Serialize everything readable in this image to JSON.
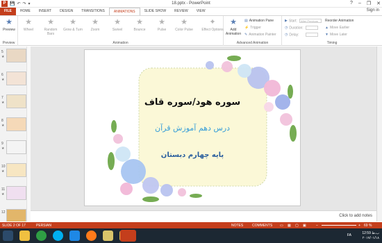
{
  "window": {
    "title": "18.pptx - PowerPoint",
    "controls": [
      "?",
      "–",
      "❐",
      "✕"
    ]
  },
  "quick_access": {
    "app_icon": "P",
    "icons": [
      "save-icon",
      "undo-icon",
      "redo-icon",
      "customize-icon"
    ]
  },
  "tabs": [
    "FILE",
    "HOME",
    "INSERT",
    "DESIGN",
    "TRANSITIONS",
    "ANIMATIONS",
    "SLIDE SHOW",
    "REVIEW",
    "VIEW"
  ],
  "active_tab": "ANIMATIONS",
  "sign_in": "Sign in",
  "ribbon": {
    "preview": {
      "label": "Preview",
      "group": "Preview"
    },
    "animation": {
      "group": "Animation",
      "effects": [
        "Wheel",
        "Random Bars",
        "Grow & Turn",
        "Zoom",
        "Swivel",
        "Bounce",
        "Pulse",
        "Color Pulse"
      ],
      "effect_options": "Effect Options"
    },
    "advanced": {
      "group": "Advanced Animation",
      "add_animation": "Add Animation",
      "animation_pane": "Animation Pane",
      "trigger": "Trigger",
      "animation_painter": "Animation Painter"
    },
    "timing": {
      "group": "Timing",
      "start": "Start:",
      "start_value": "After Previous",
      "duration": "Duration:",
      "delay": "Delay:",
      "reorder": "Reorder Animation",
      "move_earlier": "Move Earlier",
      "move_later": "Move Later"
    }
  },
  "thumbnails": [
    {
      "num": "5",
      "star": "★"
    },
    {
      "num": "6",
      "star": "★"
    },
    {
      "num": "7",
      "star": "★"
    },
    {
      "num": "8",
      "star": "★"
    },
    {
      "num": "9",
      "star": "★"
    },
    {
      "num": "10",
      "star": "★"
    },
    {
      "num": "11",
      "star": "★"
    },
    {
      "num": "12",
      "star": ""
    }
  ],
  "slide": {
    "line1": "سوره هود/سوره قاف",
    "line2": "درس دهم آموزش قرآن",
    "line3": "پایه چهارم دبستان"
  },
  "notes_placeholder": "Click to add notes",
  "status": {
    "slide_info": "SLIDE 2 OF 17",
    "language": "PERSIAN",
    "notes": "NOTES",
    "comments": "COMMENTS",
    "zoom": "69 %"
  },
  "taskbar": {
    "time": "12:59 ب.ظ",
    "date": "۲۰۱۷/۰۱/۱۸",
    "lang": "FA",
    "apps": [
      "start",
      "explorer",
      "chrome",
      "skype",
      "edge",
      "firefox",
      "files",
      "folder",
      "powerpoint"
    ]
  },
  "colors": {
    "accent": "#c43e1c",
    "taskbar": "#1c2833",
    "title_text": "#111111",
    "subtitle_text": "#3a9fd8",
    "grade_text": "#2a5f9e"
  }
}
